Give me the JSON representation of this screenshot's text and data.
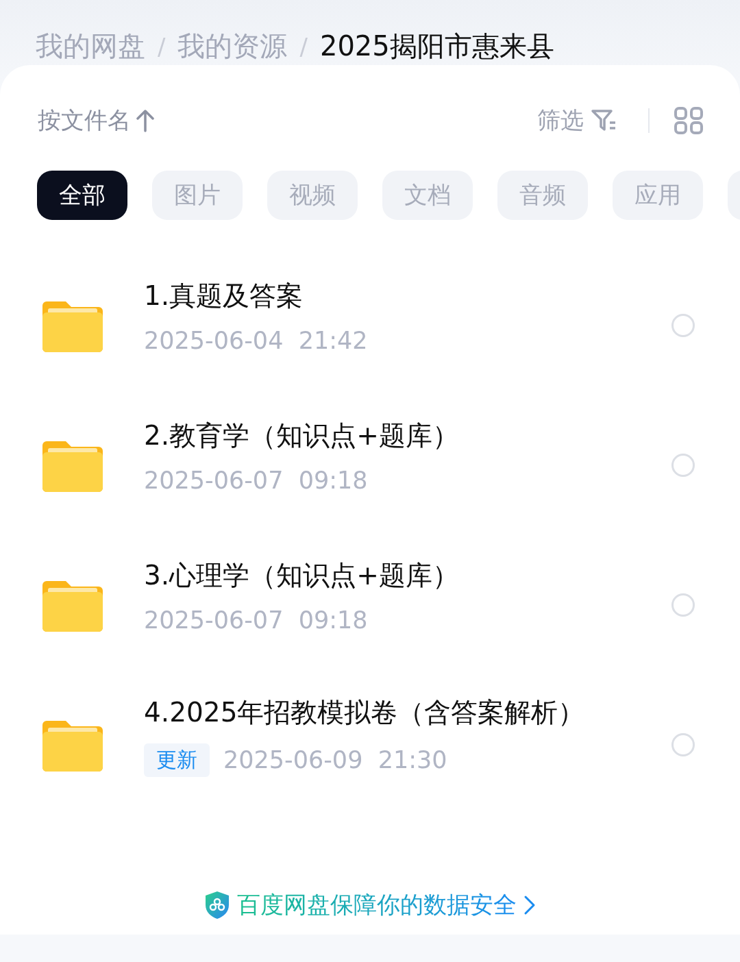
{
  "breadcrumb": {
    "separator": "/",
    "items": [
      {
        "label": "我的网盘",
        "current": false
      },
      {
        "label": "我的资源",
        "current": false
      },
      {
        "label": "2025揭阳市惠来县",
        "current": true
      }
    ]
  },
  "toolbar": {
    "sort_label": "按文件名",
    "filter_label": "筛选"
  },
  "tabs": [
    {
      "label": "全部",
      "selected": true
    },
    {
      "label": "图片",
      "selected": false
    },
    {
      "label": "视频",
      "selected": false
    },
    {
      "label": "文档",
      "selected": false
    },
    {
      "label": "音频",
      "selected": false
    },
    {
      "label": "应用",
      "selected": false
    }
  ],
  "files": [
    {
      "name": "1.真题及答案",
      "date": "2025-06-04  21:42",
      "selected": false
    },
    {
      "name": "2.教育学（知识点+题库）",
      "date": "2025-06-07  09:18",
      "selected": false
    },
    {
      "name": "3.心理学（知识点+题库）",
      "date": "2025-06-07  09:18",
      "selected": false
    },
    {
      "name": "4.2025年招教模拟卷（含答案解析）",
      "tag": "更新",
      "date": "2025-06-09  21:30",
      "selected": false
    }
  ],
  "footer": {
    "text": "百度网盘保障你的数据安全"
  }
}
